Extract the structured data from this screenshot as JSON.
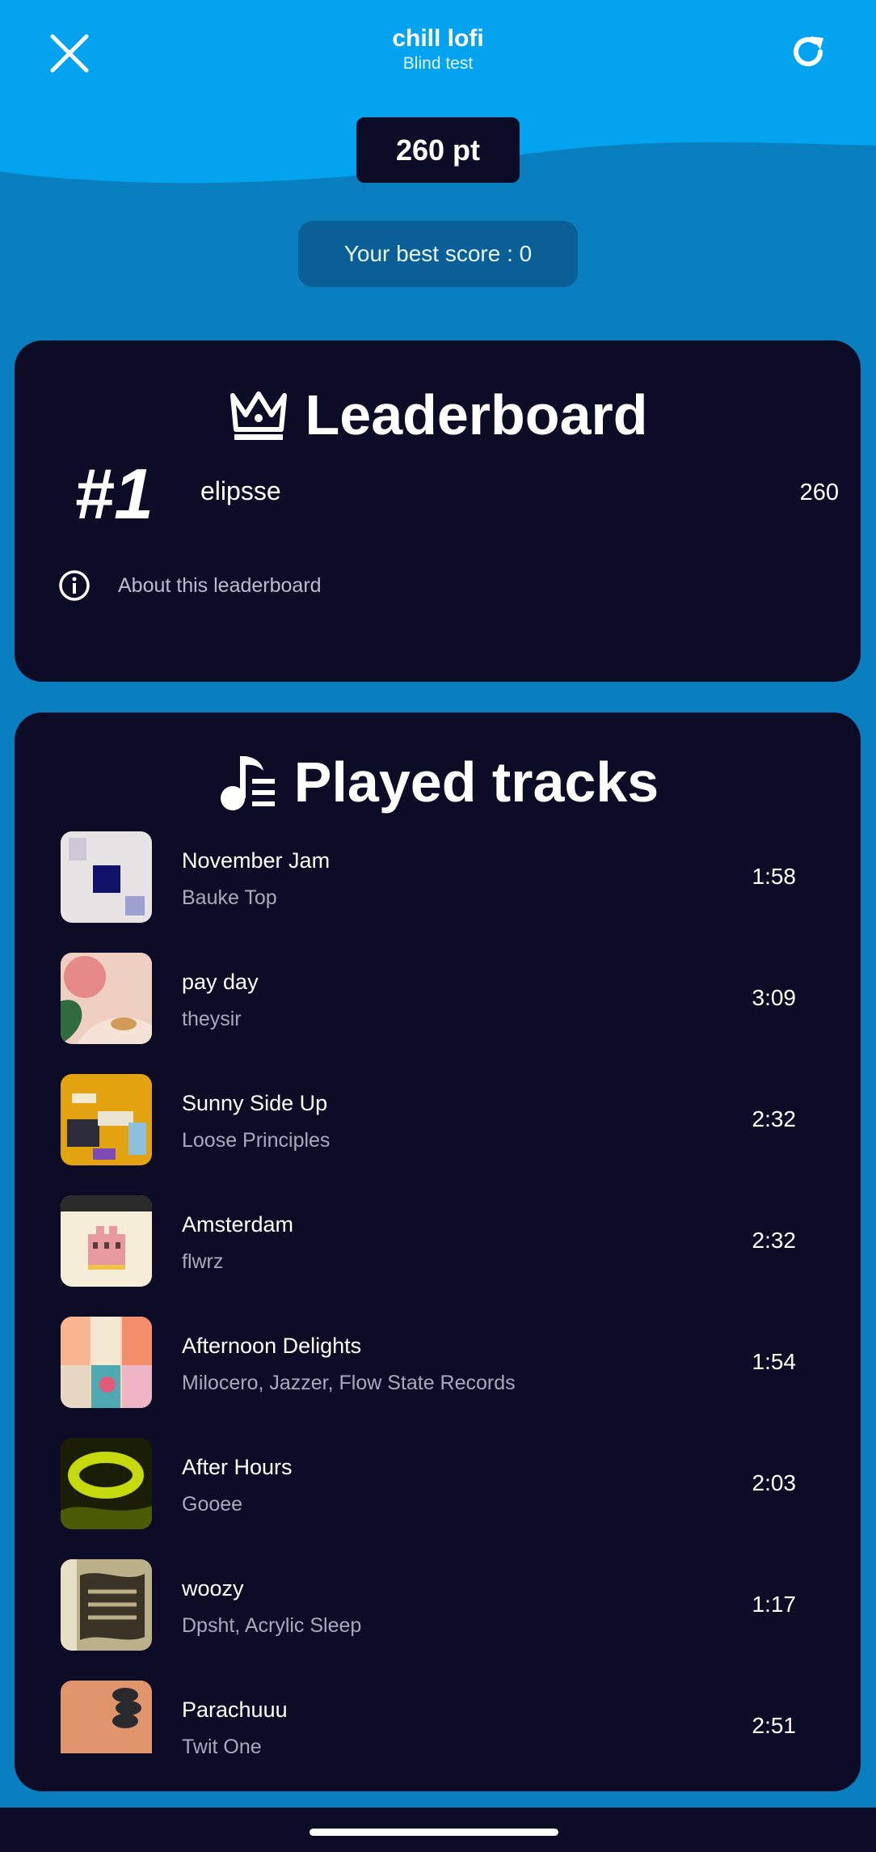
{
  "header": {
    "title": "chill lofi",
    "subtitle": "Blind test"
  },
  "score": {
    "current": "260 pt",
    "best": "Your best score : 0"
  },
  "leaderboard": {
    "heading": "Leaderboard",
    "entries": [
      {
        "rank": "#1",
        "name": "elipsse",
        "score": "260"
      }
    ],
    "about_label": "About this leaderboard"
  },
  "tracks": {
    "heading": "Played tracks",
    "items": [
      {
        "title": "November Jam",
        "artist": "Bauke Top",
        "duration": "1:58"
      },
      {
        "title": "pay day",
        "artist": "theysir",
        "duration": "3:09"
      },
      {
        "title": "Sunny Side Up",
        "artist": "Loose Principles",
        "duration": "2:32"
      },
      {
        "title": "Amsterdam",
        "artist": "flwrz",
        "duration": "2:32"
      },
      {
        "title": "Afternoon Delights",
        "artist": "Milocero, Jazzer, Flow State Records",
        "duration": "1:54"
      },
      {
        "title": "After Hours",
        "artist": "Gooee",
        "duration": "2:03"
      },
      {
        "title": "woozy",
        "artist": "Dpsht, Acrylic Sleep",
        "duration": "1:17"
      },
      {
        "title": "Parachuuu",
        "artist": "Twit One",
        "duration": "2:51"
      }
    ]
  },
  "icons": {
    "close": "close-icon",
    "refresh": "refresh-icon",
    "crown": "crown-icon",
    "info": "info-icon",
    "music": "music-list-icon"
  },
  "colors": {
    "sky": "#04a3ef",
    "wave": "#0a7fc0",
    "card": "#0c0c27",
    "best_pill": "#0a5f96"
  }
}
